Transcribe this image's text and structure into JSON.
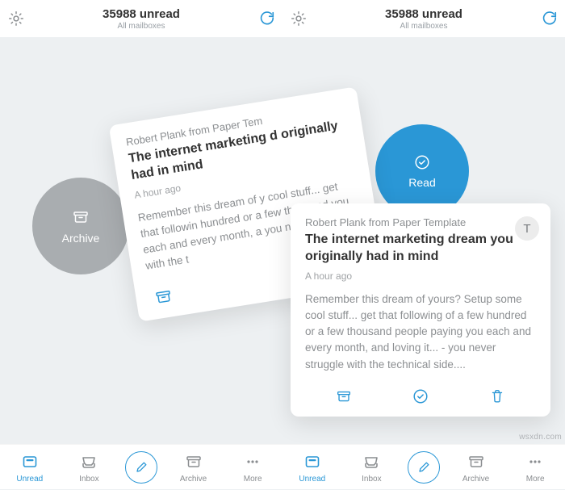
{
  "header": {
    "title": "35988 unread",
    "subtitle": "All mailboxes"
  },
  "bubbles": {
    "archive": "Archive",
    "read": "Read"
  },
  "card_tilt": {
    "sender": "Robert Plank from Paper Tem",
    "subject": "The internet marketing d originally had in mind",
    "time": "A hour ago",
    "body": "Remember this dream of y cool stuff... get that followin hundred or a few thousand you each and every month, a you never struggle with the t"
  },
  "card_flat": {
    "sender": "Robert Plank from Paper Template",
    "subject": "The internet marketing dream you originally had in mind",
    "time": "A hour ago",
    "body": "Remember this dream of yours? Setup some cool stuff... get that following of a few hundred or a few thousand people paying you each and every month, and loving it... - you never struggle with the technical side....",
    "avatar": "T"
  },
  "tabs": {
    "unread": "Unread",
    "inbox": "Inbox",
    "archive": "Archive",
    "more": "More"
  },
  "watermark": "wsxdn.com"
}
